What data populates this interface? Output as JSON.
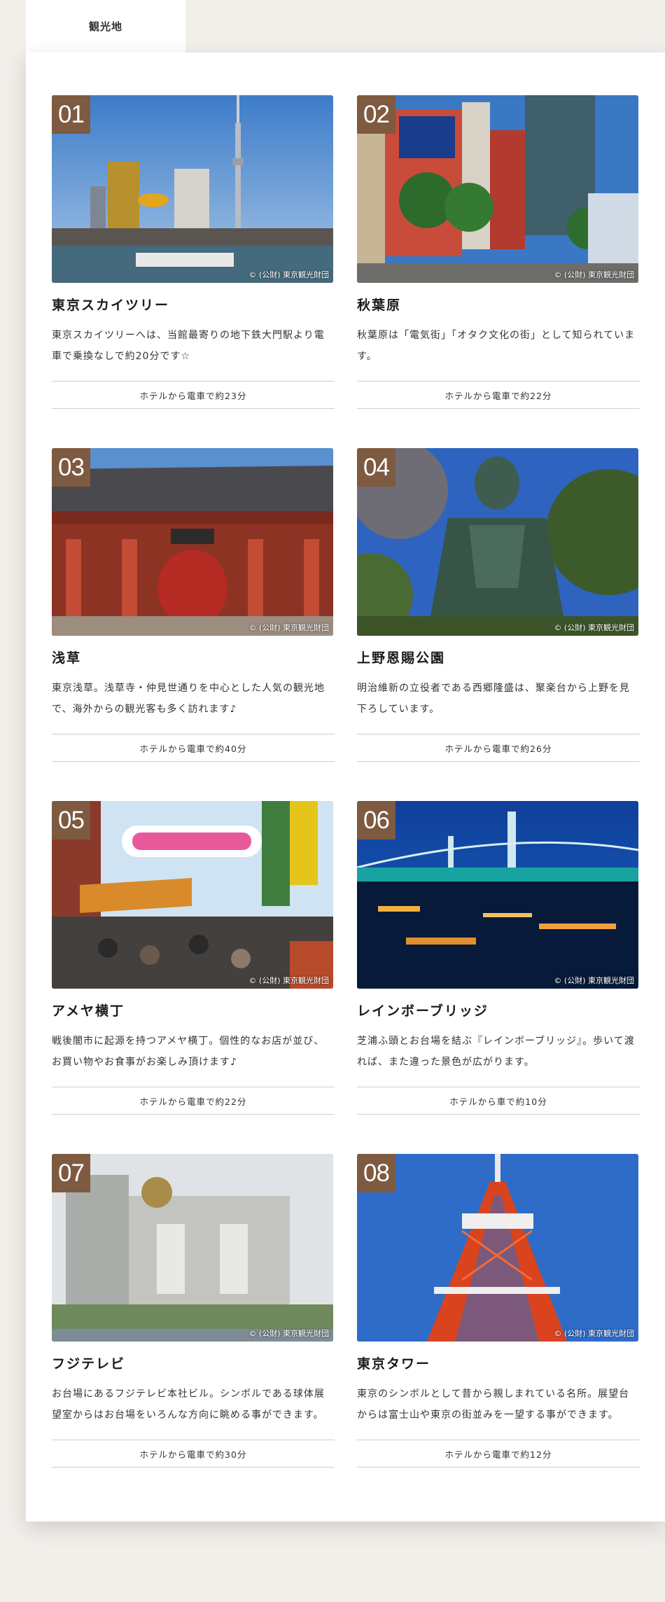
{
  "header": {
    "tab_label": "観光地"
  },
  "spots": [
    {
      "number": "01",
      "credit": "© (公財) 東京観光財団",
      "title": "東京スカイツリー",
      "desc": "東京スカイツリーへは、当館最寄りの地下鉄大門駅より電車で乗換なしで約20分です☆",
      "access": "ホテルから電車で約23分"
    },
    {
      "number": "02",
      "credit": "© (公財) 東京観光財団",
      "title": "秋葉原",
      "desc": "秋葉原は「電気街」「オタク文化の街」として知られています。",
      "access": "ホテルから電車で約22分"
    },
    {
      "number": "03",
      "credit": "© (公財) 東京観光財団",
      "title": "浅草",
      "desc": "東京浅草。浅草寺・仲見世通りを中心とした人気の観光地で、海外からの観光客も多く訪れます♪",
      "access": "ホテルから電車で約40分"
    },
    {
      "number": "04",
      "credit": "© (公財) 東京観光財団",
      "title": "上野恩賜公園",
      "desc": "明治維新の立役者である西郷隆盛は、聚楽台から上野を見下ろしています。",
      "access": "ホテルから電車で約26分"
    },
    {
      "number": "05",
      "credit": "© (公財) 東京観光財団",
      "title": "アメヤ横丁",
      "desc": "戦後闇市に起源を持つアメヤ横丁。個性的なお店が並び、お買い物やお食事がお楽しみ頂けます♪",
      "access": "ホテルから電車で約22分"
    },
    {
      "number": "06",
      "credit": "© (公財) 東京観光財団",
      "title": "レインボーブリッジ",
      "desc": "芝浦ふ頭とお台場を結ぶ『レインボーブリッジ』。歩いて渡れば、また違った景色が広がります。",
      "access": "ホテルから車で約10分"
    },
    {
      "number": "07",
      "credit": "© (公財) 東京観光財団",
      "title": "フジテレビ",
      "desc": "お台場にあるフジテレビ本社ビル。シンボルである球体展望室からはお台場をいろんな方向に眺める事ができます。",
      "access": "ホテルから電車で約30分"
    },
    {
      "number": "08",
      "credit": "© (公財) 東京観光財団",
      "title": "東京タワー",
      "desc": "東京のシンボルとして昔から親しまれている名所。展望台からは富士山や東京の街並みを一望する事ができます。",
      "access": "ホテルから電車で約12分"
    }
  ],
  "colors": {
    "number_badge": "#7d5a40",
    "page_bg": "#f2efeb",
    "panel_bg": "#ffffff"
  }
}
